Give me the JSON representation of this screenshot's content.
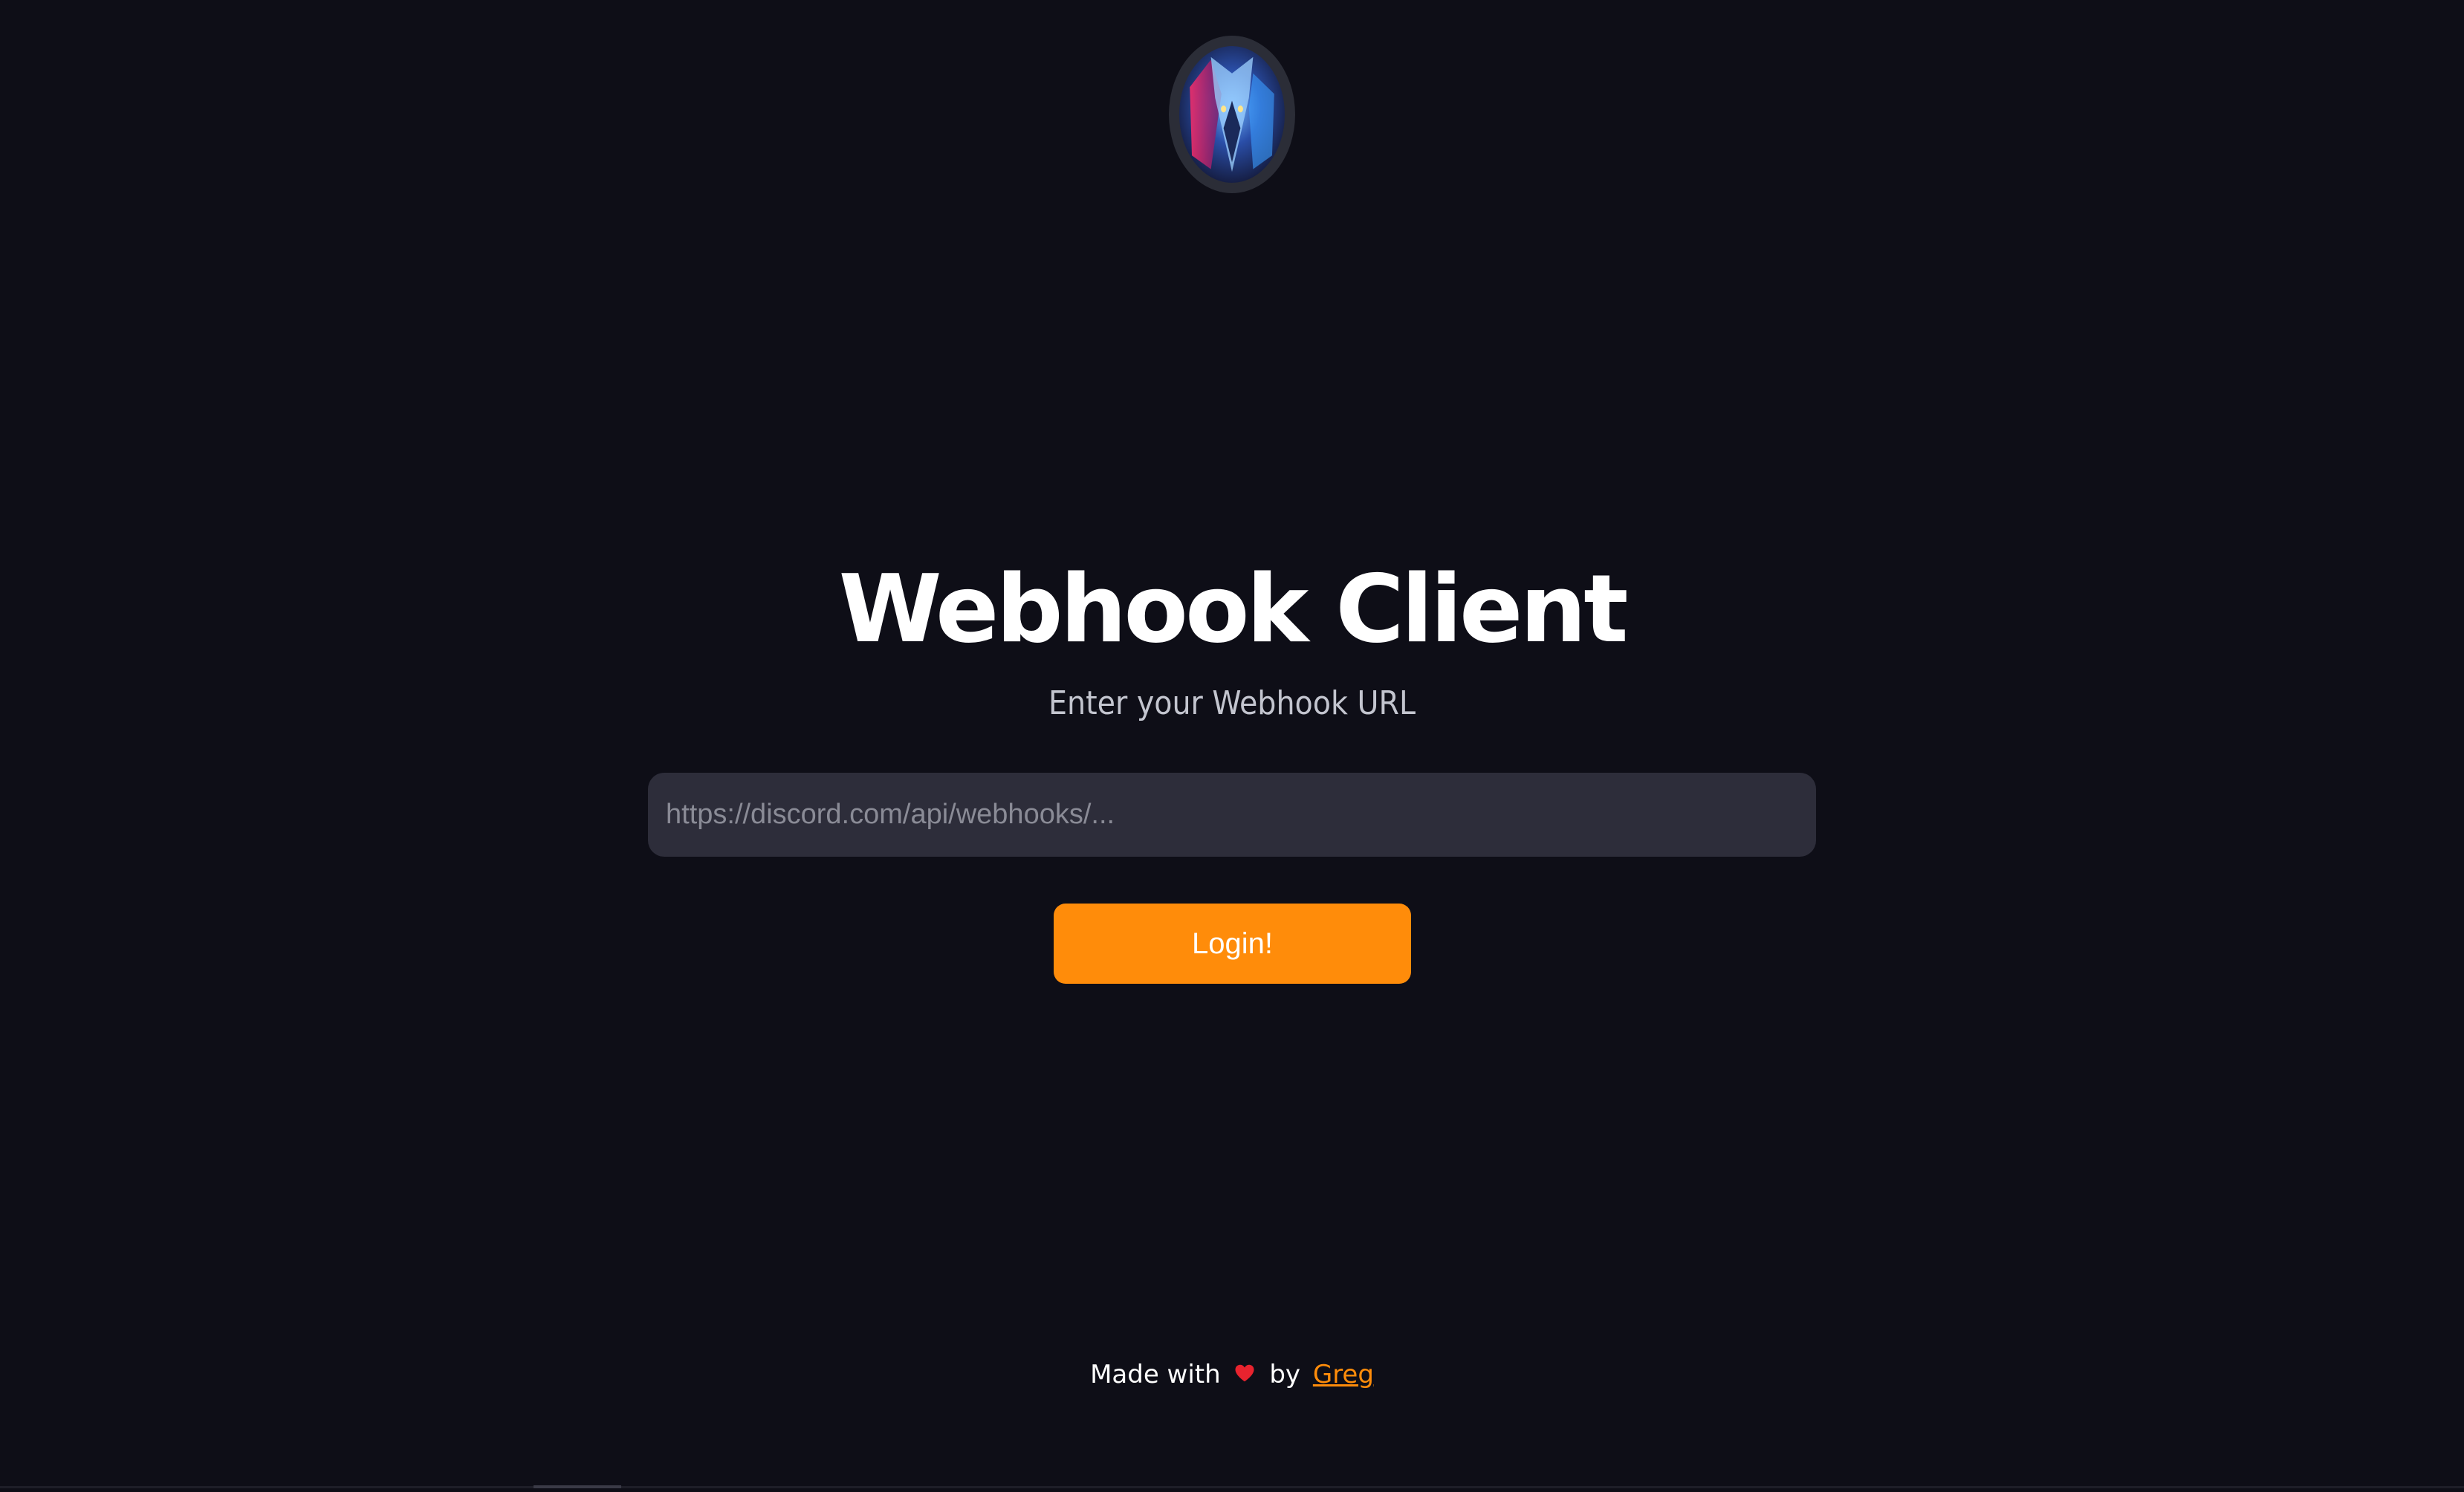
{
  "app": {
    "title": "Webhook Client",
    "subtitle": "Enter your Webhook URL"
  },
  "avatar": {
    "icon": "wolf-avatar-icon"
  },
  "form": {
    "url_placeholder": "https://discord.com/api/webhooks/...",
    "url_value": "",
    "login_label": "Login!"
  },
  "footer": {
    "made_with": "Made with",
    "heart_icon": "heart-icon",
    "by": "by",
    "author": "Greg"
  },
  "colors": {
    "background": "#0e0e17",
    "accent": "#ff8c0a",
    "input_bg": "#2d2d3a",
    "heart": "#e8232e"
  }
}
